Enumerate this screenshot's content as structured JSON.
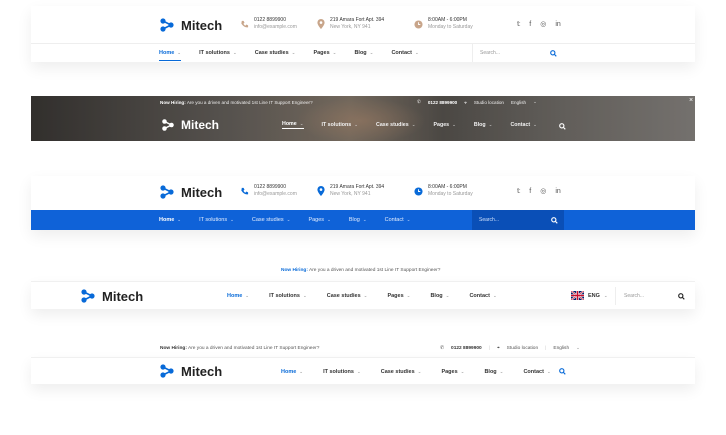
{
  "brand": {
    "name": "Mitech"
  },
  "contact": {
    "phone": "0122 8899900",
    "email": "info@example.com",
    "address_line1": "219 Amara Fort Apt. 394",
    "address_line2": "New York, NY 941",
    "hours_line1": "8:00AM - 6:00PM",
    "hours_line2": "Monday to Saturday"
  },
  "social": {
    "twitter": "twitter-icon",
    "facebook": "facebook-icon",
    "instagram": "instagram-icon",
    "linkedin": "linkedin-icon"
  },
  "nav": {
    "home": "Home",
    "it_solutions": "IT solutions",
    "case_studies": "Case studies",
    "pages": "Pages",
    "blog": "Blog",
    "contact": "Contact"
  },
  "search": {
    "placeholder": "Search..."
  },
  "topbar": {
    "hiring_label": "Now Hiring:",
    "hiring_text": "Are you a driven and motivated 1st Line IT Support Engineer?",
    "location": "Studio location",
    "language": "English",
    "close": "×"
  },
  "lang_short": "ENG",
  "colors": {
    "accent": "#086ad8",
    "bar_blue": "#0f62d8",
    "search_blue": "#0a4fb7",
    "photo_dark": "#5a5753"
  }
}
